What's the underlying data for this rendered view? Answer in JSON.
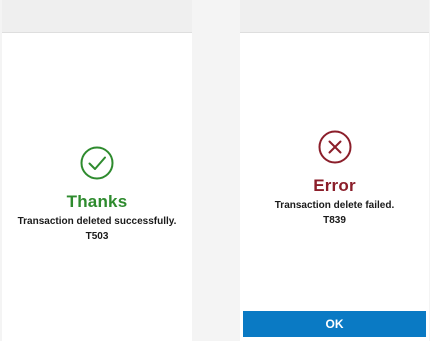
{
  "colors": {
    "success": "#2e8b2e",
    "error": "#8b1e2a",
    "button_bg": "#0a7ac4",
    "button_text": "#ffffff"
  },
  "success_panel": {
    "icon": "check-circle-icon",
    "title": "Thanks",
    "message": "Transaction deleted successfully.",
    "code": "T503"
  },
  "error_panel": {
    "icon": "x-circle-icon",
    "title": "Error",
    "message": "Transaction delete failed.",
    "code": "T839",
    "ok_label": "OK"
  }
}
